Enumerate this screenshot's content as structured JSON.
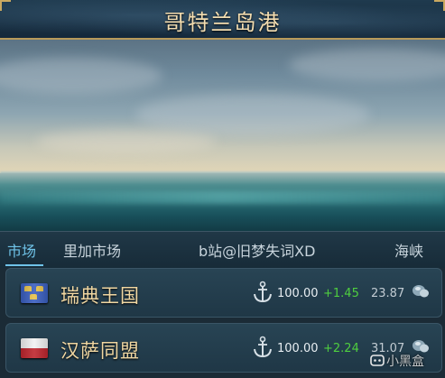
{
  "header": {
    "title": "哥特兰岛港"
  },
  "tabs": [
    {
      "label": "市场",
      "active": true
    },
    {
      "label": "里加市场",
      "active": false
    },
    {
      "label": "b站@旧梦失词XD",
      "active": false
    },
    {
      "label": "海峡",
      "active": false
    }
  ],
  "rows": [
    {
      "name": "瑞典王国",
      "flag": "sweden-flag",
      "value": "100.00",
      "change": "+1.45",
      "price": "23.87"
    },
    {
      "name": "汉萨同盟",
      "flag": "hansa-flag",
      "value": "100.00",
      "change": "+2.24",
      "price": "31.07"
    }
  ],
  "watermark": {
    "text": "小黑盒"
  },
  "colors": {
    "title": "#f3ddb0",
    "active_tab": "#6fc3e8",
    "row_name": "#f0d7a2",
    "positive_change": "#4fce3f"
  },
  "icons": [
    "anchor-icon",
    "goods-icon",
    "sweden-flag",
    "hansa-flag"
  ]
}
